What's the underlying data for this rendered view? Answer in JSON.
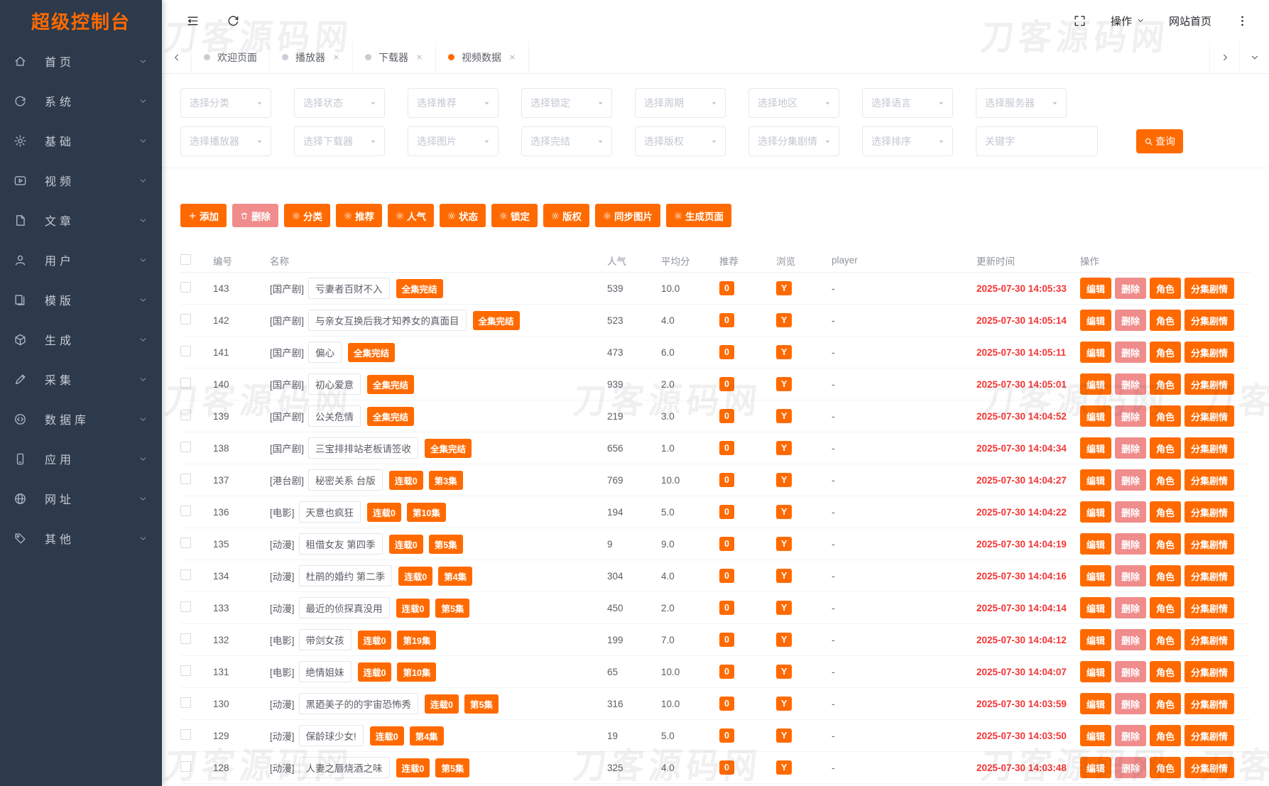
{
  "app": {
    "title": "超级控制台"
  },
  "watermark": {
    "text": "刀客源码网"
  },
  "colors": {
    "accent": "#ff6a00",
    "delete_soft": "#f08c8c",
    "time_red": "#f53535",
    "sidebar_bg": "#2d3a4b"
  },
  "sidebar": {
    "items": [
      {
        "icon": "home-icon",
        "label": "首页"
      },
      {
        "icon": "system-icon",
        "label": "系统"
      },
      {
        "icon": "gear-icon",
        "label": "基础"
      },
      {
        "icon": "video-icon",
        "label": "视频"
      },
      {
        "icon": "article-icon",
        "label": "文章"
      },
      {
        "icon": "user-icon",
        "label": "用户"
      },
      {
        "icon": "template-icon",
        "label": "模版"
      },
      {
        "icon": "generate-icon",
        "label": "生成"
      },
      {
        "icon": "collect-icon",
        "label": "采集"
      },
      {
        "icon": "database-icon",
        "label": "数据库"
      },
      {
        "icon": "app-icon",
        "label": "应用"
      },
      {
        "icon": "url-icon",
        "label": "网址"
      },
      {
        "icon": "other-icon",
        "label": "其他"
      }
    ]
  },
  "topbar": {
    "icons": [
      "menu-fold-icon",
      "refresh-icon",
      "expand-icon",
      "more-vertical-icon"
    ],
    "operation_label": "操作",
    "site_home_label": "网站首页"
  },
  "tabbar": {
    "tabs": [
      {
        "label": "欢迎页面",
        "active": false,
        "closable": false
      },
      {
        "label": "播放器",
        "active": false,
        "closable": true
      },
      {
        "label": "下载器",
        "active": false,
        "closable": true
      },
      {
        "label": "视频数据",
        "active": true,
        "closable": true
      }
    ]
  },
  "filters": {
    "row1": [
      "选择分类",
      "选择状态",
      "选择推荐",
      "选择锁定",
      "选择周期",
      "选择地区",
      "选择语言",
      "选择服务器"
    ],
    "row2": [
      "选择播放器",
      "选择下载器",
      "选择图片",
      "选择完结",
      "选择版权",
      "选择分集剧情",
      "选择排序"
    ],
    "keyword_placeholder": "关键字",
    "search_label": "查询"
  },
  "actions": {
    "buttons": [
      {
        "icon": "plus-icon",
        "label": "添加"
      },
      {
        "icon": "trash-icon",
        "label": "删除",
        "pink": true
      },
      {
        "icon": "gear-icon",
        "label": "分类"
      },
      {
        "icon": "gear-icon",
        "label": "推荐"
      },
      {
        "icon": "gear-icon",
        "label": "人气"
      },
      {
        "icon": "gear-icon",
        "label": "状态"
      },
      {
        "icon": "gear-icon",
        "label": "锁定"
      },
      {
        "icon": "gear-icon",
        "label": "版权"
      },
      {
        "icon": "gear-icon",
        "label": "同步图片"
      },
      {
        "icon": "gear-icon",
        "label": "生成页面"
      }
    ]
  },
  "table": {
    "headers": {
      "id": "编号",
      "name": "名称",
      "popularity": "人气",
      "score": "平均分",
      "recommend": "推荐",
      "browse": "浏览",
      "player": "player",
      "updated": "更新时间",
      "ops": "操作"
    },
    "row_actions": [
      "编辑",
      "删除",
      "角色",
      "分集剧情"
    ],
    "rows": [
      {
        "id": "143",
        "category": "[国产剧]",
        "title": "亏妻者百财不入",
        "tags": [
          "全集完结"
        ],
        "popularity": "539",
        "score": "10.0",
        "recommend": "0",
        "browse": "Y",
        "player": "-",
        "updated": "2025-07-30 14:05:33"
      },
      {
        "id": "142",
        "category": "[国产剧]",
        "title": "与亲女互换后我才知养女的真面目",
        "tags": [
          "全集完结"
        ],
        "popularity": "523",
        "score": "4.0",
        "recommend": "0",
        "browse": "Y",
        "player": "-",
        "updated": "2025-07-30 14:05:14"
      },
      {
        "id": "141",
        "category": "[国产剧]",
        "title": "偏心",
        "tags": [
          "全集完结"
        ],
        "popularity": "473",
        "score": "6.0",
        "recommend": "0",
        "browse": "Y",
        "player": "-",
        "updated": "2025-07-30 14:05:11"
      },
      {
        "id": "140",
        "category": "[国产剧]",
        "title": "初心爱意",
        "tags": [
          "全集完结"
        ],
        "popularity": "939",
        "score": "2.0",
        "recommend": "0",
        "browse": "Y",
        "player": "-",
        "updated": "2025-07-30 14:05:01"
      },
      {
        "id": "139",
        "category": "[国产剧]",
        "title": "公关危情",
        "tags": [
          "全集完结"
        ],
        "popularity": "219",
        "score": "3.0",
        "recommend": "0",
        "browse": "Y",
        "player": "-",
        "updated": "2025-07-30 14:04:52"
      },
      {
        "id": "138",
        "category": "[国产剧]",
        "title": "三宝排排站老板请签收",
        "tags": [
          "全集完结"
        ],
        "popularity": "656",
        "score": "1.0",
        "recommend": "0",
        "browse": "Y",
        "player": "-",
        "updated": "2025-07-30 14:04:34"
      },
      {
        "id": "137",
        "category": "[港台剧]",
        "title": "秘密关系 台版",
        "tags": [
          "连载0",
          "第3集"
        ],
        "popularity": "769",
        "score": "10.0",
        "recommend": "0",
        "browse": "Y",
        "player": "-",
        "updated": "2025-07-30 14:04:27"
      },
      {
        "id": "136",
        "category": "[电影]",
        "title": "天意也疯狂",
        "tags": [
          "连载0",
          "第10集"
        ],
        "popularity": "194",
        "score": "5.0",
        "recommend": "0",
        "browse": "Y",
        "player": "-",
        "updated": "2025-07-30 14:04:22"
      },
      {
        "id": "135",
        "category": "[动漫]",
        "title": "租借女友 第四季",
        "tags": [
          "连载0",
          "第5集"
        ],
        "popularity": "9",
        "score": "9.0",
        "recommend": "0",
        "browse": "Y",
        "player": "-",
        "updated": "2025-07-30 14:04:19"
      },
      {
        "id": "134",
        "category": "[动漫]",
        "title": "杜鹃的婚约 第二季",
        "tags": [
          "连载0",
          "第4集"
        ],
        "popularity": "304",
        "score": "4.0",
        "recommend": "0",
        "browse": "Y",
        "player": "-",
        "updated": "2025-07-30 14:04:16"
      },
      {
        "id": "133",
        "category": "[动漫]",
        "title": "最近的侦探真没用",
        "tags": [
          "连载0",
          "第5集"
        ],
        "popularity": "450",
        "score": "2.0",
        "recommend": "0",
        "browse": "Y",
        "player": "-",
        "updated": "2025-07-30 14:04:14"
      },
      {
        "id": "132",
        "category": "[电影]",
        "title": "带剑女孩",
        "tags": [
          "连载0",
          "第19集"
        ],
        "popularity": "199",
        "score": "7.0",
        "recommend": "0",
        "browse": "Y",
        "player": "-",
        "updated": "2025-07-30 14:04:12"
      },
      {
        "id": "131",
        "category": "[电影]",
        "title": "绝情姐妹",
        "tags": [
          "连载0",
          "第10集"
        ],
        "popularity": "65",
        "score": "10.0",
        "recommend": "0",
        "browse": "Y",
        "player": "-",
        "updated": "2025-07-30 14:04:07"
      },
      {
        "id": "130",
        "category": "[动漫]",
        "title": "黑廼美子的的宇宙恐怖秀",
        "tags": [
          "连载0",
          "第5集"
        ],
        "popularity": "316",
        "score": "10.0",
        "recommend": "0",
        "browse": "Y",
        "player": "-",
        "updated": "2025-07-30 14:03:59"
      },
      {
        "id": "129",
        "category": "[动漫]",
        "title": "保龄球少女!",
        "tags": [
          "连载0",
          "第4集"
        ],
        "popularity": "19",
        "score": "5.0",
        "recommend": "0",
        "browse": "Y",
        "player": "-",
        "updated": "2025-07-30 14:03:50"
      },
      {
        "id": "128",
        "category": "[动漫]",
        "title": "人妻之唇烧酒之味",
        "tags": [
          "连载0",
          "第5集"
        ],
        "popularity": "325",
        "score": "4.0",
        "recommend": "0",
        "browse": "Y",
        "player": "-",
        "updated": "2025-07-30 14:03:48"
      }
    ]
  }
}
